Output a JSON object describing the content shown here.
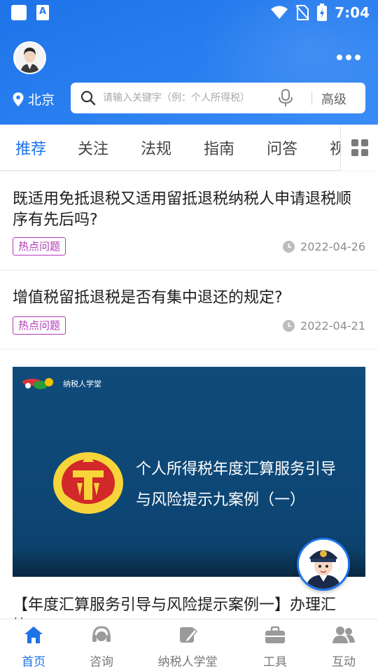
{
  "status_bar": {
    "time": "7:04",
    "icon_b_letter": "A"
  },
  "header": {
    "city": "北京",
    "search": {
      "placeholder": "请输入关键字（例：个人所得税）",
      "advanced_label": "高级"
    }
  },
  "tabs": [
    {
      "label": "推荐",
      "active": true
    },
    {
      "label": "关注"
    },
    {
      "label": "法规"
    },
    {
      "label": "指南"
    },
    {
      "label": "问答"
    },
    {
      "label": "视"
    }
  ],
  "articles": [
    {
      "title": "既适用免抵退税又适用留抵退税纳税人申请退税顺序有先后吗?",
      "tag": "热点问题",
      "date": "2022-04-26"
    },
    {
      "title": "增值税留抵退税是否有集中退还的规定?",
      "tag": "热点问题",
      "date": "2022-04-21"
    }
  ],
  "video_card": {
    "brand_text": "纳税人学堂",
    "slide_line1": "个人所得税年度汇算服务引导",
    "slide_line2": "与风险提示九案例（一）",
    "title": "【年度汇算服务引导与风险提示案例一】办理汇算..."
  },
  "bottom_nav": [
    {
      "label": "首页",
      "icon": "home-icon",
      "active": true
    },
    {
      "label": "咨询",
      "icon": "headset-icon"
    },
    {
      "label": "纳税人学堂",
      "icon": "edit-icon"
    },
    {
      "label": "工具",
      "icon": "toolbox-icon"
    },
    {
      "label": "互动",
      "icon": "people-icon"
    }
  ],
  "colors": {
    "primary": "#1e73e8",
    "tag": "#b23bb9"
  }
}
